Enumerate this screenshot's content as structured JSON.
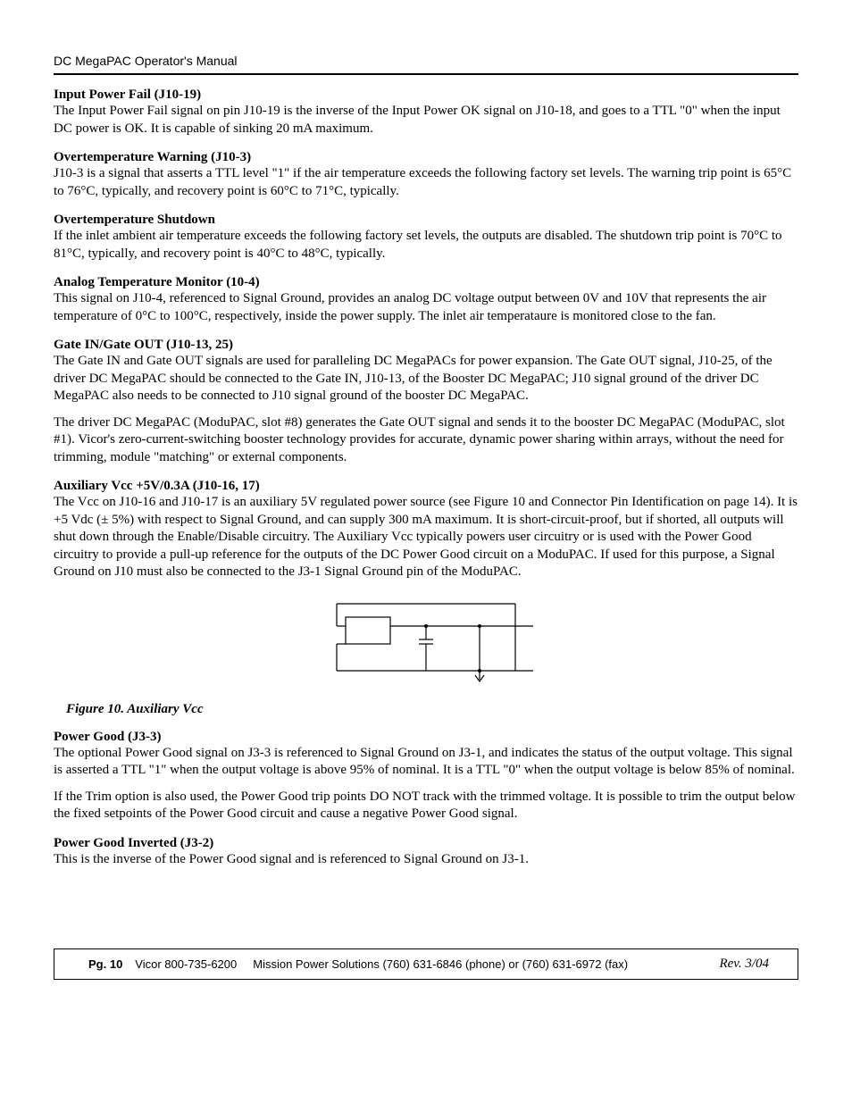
{
  "header": {
    "manual_title": "DC MegaPAC Operator's Manual"
  },
  "sections": {
    "s1": {
      "heading": "Input Power Fail (J10-19)",
      "body": "The Input Power Fail signal on pin J10-19 is the inverse of the Input Power OK signal on J10-18, and goes to a TTL \"0\" when the input DC power is OK. It is capable of sinking 20 mA maximum."
    },
    "s2": {
      "heading": "Overtemperature Warning (J10-3)",
      "body": "J10-3 is a signal that asserts a TTL level \"1\" if the air temperature exceeds the following factory set levels. The warning trip point is 65°C to 76°C, typically, and recovery point is 60°C to 71°C, typically."
    },
    "s3": {
      "heading": "Overtemperature Shutdown",
      "body": "If the inlet ambient air temperature exceeds the following factory set levels, the outputs are disabled. The shutdown trip point is 70°C to 81°C, typically, and recovery point is 40°C to 48°C, typically."
    },
    "s4": {
      "heading": "Analog Temperature Monitor (10-4)",
      "body": "This signal on J10-4, referenced to Signal Ground, provides an analog DC voltage output between 0V and 10V that represents the air temperature of 0°C to 100°C, respectively, inside the power supply. The inlet air temperataure is monitored close to the fan."
    },
    "s5": {
      "heading": "Gate IN/Gate OUT (J10-13, 25)",
      "body1": "The Gate IN and Gate OUT signals are used for paralleling DC MegaPACs for power expansion. The Gate OUT signal, J10-25, of the driver DC MegaPAC should be connected to the Gate IN, J10-13, of the Booster DC MegaPAC; J10 signal ground of the driver DC MegaPAC also needs to be connected to J10 signal ground of the booster DC MegaPAC.",
      "body2": "The driver DC MegaPAC (ModuPAC, slot #8) generates the Gate OUT signal and sends it to the booster DC MegaPAC (ModuPAC, slot #1). Vicor's zero-current-switching booster technology provides for accurate, dynamic power sharing within arrays, without the need for trimming, module \"matching\" or external components."
    },
    "s6": {
      "heading": "Auxiliary Vcc +5V/0.3A (J10-16, 17)",
      "body": "The Vcc on J10-16 and J10-17 is an auxiliary 5V regulated power source (see Figure 10 and Connector Pin Identification on page 14). It is +5 Vdc (± 5%) with respect to Signal Ground, and can supply 300 mA maximum. It is short-circuit-proof, but if shorted, all outputs will shut down through the Enable/Disable circuitry. The Auxiliary Vcc typically powers user circuitry or is used with the Power Good circuitry to provide a pull-up reference for the outputs of the DC Power Good circuit on a ModuPAC. If used for this purpose, a Signal Ground on J10 must also be connected to the J3-1 Signal Ground pin of the ModuPAC."
    },
    "figure": {
      "caption": "Figure 10. Auxiliary Vcc"
    },
    "s7": {
      "heading": "Power Good (J3-3)",
      "body1": "The optional Power Good signal on J3-3 is referenced to Signal Ground on J3-1, and indicates the status of the output voltage. This signal is asserted a TTL \"1\" when the output voltage is above 95% of nominal. It is a TTL \"0\" when the output voltage is below 85% of nominal.",
      "body2": "If the Trim option is also used, the Power Good trip points DO NOT track with the trimmed voltage. It is possible to trim the output below the fixed setpoints of the Power Good circuit and cause a negative Power Good signal."
    },
    "s8": {
      "heading": "Power Good Inverted (J3-2)",
      "body": "This is the inverse of the Power Good signal and is referenced to Signal Ground on J3-1."
    }
  },
  "footer": {
    "page": "Pg. 10",
    "vicor": "Vicor 800-735-6200",
    "mission": "Mission Power Solutions (760) 631-6846 (phone) or (760) 631-6972 (fax)",
    "rev": "Rev. 3/04"
  }
}
